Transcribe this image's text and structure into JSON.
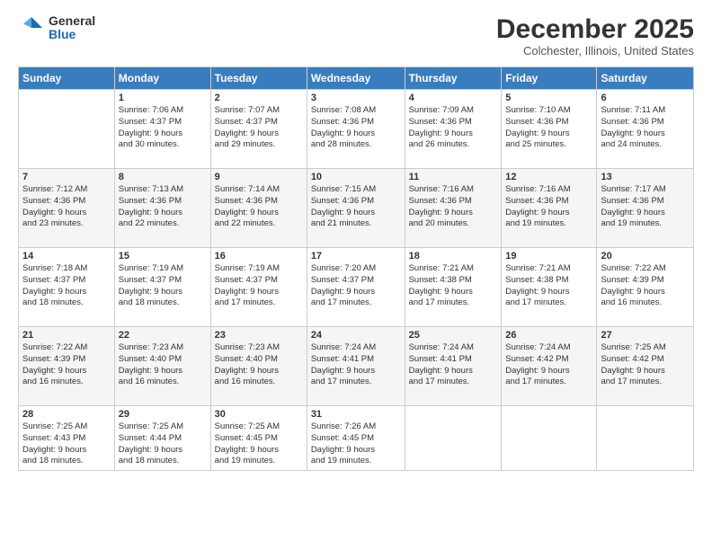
{
  "header": {
    "logo_general": "General",
    "logo_blue": "Blue",
    "title": "December 2025",
    "location": "Colchester, Illinois, United States"
  },
  "weekdays": [
    "Sunday",
    "Monday",
    "Tuesday",
    "Wednesday",
    "Thursday",
    "Friday",
    "Saturday"
  ],
  "weeks": [
    [
      {
        "day": "",
        "info": ""
      },
      {
        "day": "1",
        "info": "Sunrise: 7:06 AM\nSunset: 4:37 PM\nDaylight: 9 hours\nand 30 minutes."
      },
      {
        "day": "2",
        "info": "Sunrise: 7:07 AM\nSunset: 4:37 PM\nDaylight: 9 hours\nand 29 minutes."
      },
      {
        "day": "3",
        "info": "Sunrise: 7:08 AM\nSunset: 4:36 PM\nDaylight: 9 hours\nand 28 minutes."
      },
      {
        "day": "4",
        "info": "Sunrise: 7:09 AM\nSunset: 4:36 PM\nDaylight: 9 hours\nand 26 minutes."
      },
      {
        "day": "5",
        "info": "Sunrise: 7:10 AM\nSunset: 4:36 PM\nDaylight: 9 hours\nand 25 minutes."
      },
      {
        "day": "6",
        "info": "Sunrise: 7:11 AM\nSunset: 4:36 PM\nDaylight: 9 hours\nand 24 minutes."
      }
    ],
    [
      {
        "day": "7",
        "info": "Sunrise: 7:12 AM\nSunset: 4:36 PM\nDaylight: 9 hours\nand 23 minutes."
      },
      {
        "day": "8",
        "info": "Sunrise: 7:13 AM\nSunset: 4:36 PM\nDaylight: 9 hours\nand 22 minutes."
      },
      {
        "day": "9",
        "info": "Sunrise: 7:14 AM\nSunset: 4:36 PM\nDaylight: 9 hours\nand 22 minutes."
      },
      {
        "day": "10",
        "info": "Sunrise: 7:15 AM\nSunset: 4:36 PM\nDaylight: 9 hours\nand 21 minutes."
      },
      {
        "day": "11",
        "info": "Sunrise: 7:16 AM\nSunset: 4:36 PM\nDaylight: 9 hours\nand 20 minutes."
      },
      {
        "day": "12",
        "info": "Sunrise: 7:16 AM\nSunset: 4:36 PM\nDaylight: 9 hours\nand 19 minutes."
      },
      {
        "day": "13",
        "info": "Sunrise: 7:17 AM\nSunset: 4:36 PM\nDaylight: 9 hours\nand 19 minutes."
      }
    ],
    [
      {
        "day": "14",
        "info": "Sunrise: 7:18 AM\nSunset: 4:37 PM\nDaylight: 9 hours\nand 18 minutes."
      },
      {
        "day": "15",
        "info": "Sunrise: 7:19 AM\nSunset: 4:37 PM\nDaylight: 9 hours\nand 18 minutes."
      },
      {
        "day": "16",
        "info": "Sunrise: 7:19 AM\nSunset: 4:37 PM\nDaylight: 9 hours\nand 17 minutes."
      },
      {
        "day": "17",
        "info": "Sunrise: 7:20 AM\nSunset: 4:37 PM\nDaylight: 9 hours\nand 17 minutes."
      },
      {
        "day": "18",
        "info": "Sunrise: 7:21 AM\nSunset: 4:38 PM\nDaylight: 9 hours\nand 17 minutes."
      },
      {
        "day": "19",
        "info": "Sunrise: 7:21 AM\nSunset: 4:38 PM\nDaylight: 9 hours\nand 17 minutes."
      },
      {
        "day": "20",
        "info": "Sunrise: 7:22 AM\nSunset: 4:39 PM\nDaylight: 9 hours\nand 16 minutes."
      }
    ],
    [
      {
        "day": "21",
        "info": "Sunrise: 7:22 AM\nSunset: 4:39 PM\nDaylight: 9 hours\nand 16 minutes."
      },
      {
        "day": "22",
        "info": "Sunrise: 7:23 AM\nSunset: 4:40 PM\nDaylight: 9 hours\nand 16 minutes."
      },
      {
        "day": "23",
        "info": "Sunrise: 7:23 AM\nSunset: 4:40 PM\nDaylight: 9 hours\nand 16 minutes."
      },
      {
        "day": "24",
        "info": "Sunrise: 7:24 AM\nSunset: 4:41 PM\nDaylight: 9 hours\nand 17 minutes."
      },
      {
        "day": "25",
        "info": "Sunrise: 7:24 AM\nSunset: 4:41 PM\nDaylight: 9 hours\nand 17 minutes."
      },
      {
        "day": "26",
        "info": "Sunrise: 7:24 AM\nSunset: 4:42 PM\nDaylight: 9 hours\nand 17 minutes."
      },
      {
        "day": "27",
        "info": "Sunrise: 7:25 AM\nSunset: 4:42 PM\nDaylight: 9 hours\nand 17 minutes."
      }
    ],
    [
      {
        "day": "28",
        "info": "Sunrise: 7:25 AM\nSunset: 4:43 PM\nDaylight: 9 hours\nand 18 minutes."
      },
      {
        "day": "29",
        "info": "Sunrise: 7:25 AM\nSunset: 4:44 PM\nDaylight: 9 hours\nand 18 minutes."
      },
      {
        "day": "30",
        "info": "Sunrise: 7:25 AM\nSunset: 4:45 PM\nDaylight: 9 hours\nand 19 minutes."
      },
      {
        "day": "31",
        "info": "Sunrise: 7:26 AM\nSunset: 4:45 PM\nDaylight: 9 hours\nand 19 minutes."
      },
      {
        "day": "",
        "info": ""
      },
      {
        "day": "",
        "info": ""
      },
      {
        "day": "",
        "info": ""
      }
    ]
  ]
}
